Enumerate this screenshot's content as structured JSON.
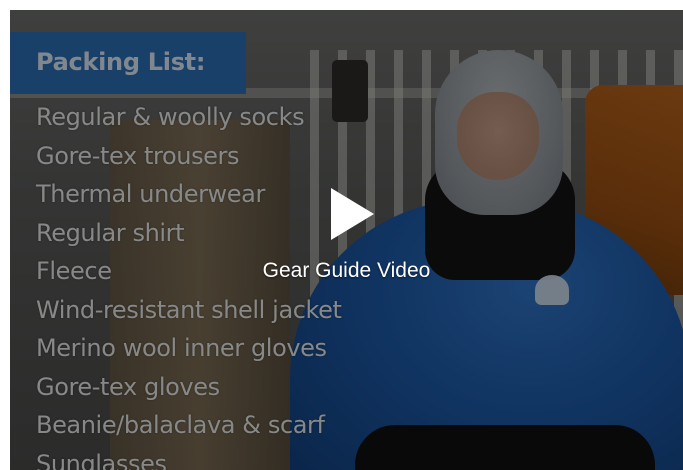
{
  "video": {
    "caption": "Gear Guide Video",
    "play_icon": "play-icon"
  },
  "packing_list": {
    "title": "Packing List:",
    "items": [
      "Regular & woolly socks",
      "Gore-tex trousers",
      "Thermal underwear",
      "Regular shirt",
      "Fleece",
      "Wind-resistant shell jacket",
      "Merino wool inner gloves",
      "Gore-tex gloves",
      "Beanie/balaclava & scarf",
      "Sunglasses"
    ]
  },
  "colors": {
    "header_blue": "#2b6fb6",
    "jacket_blue": "#1d5aa8"
  }
}
